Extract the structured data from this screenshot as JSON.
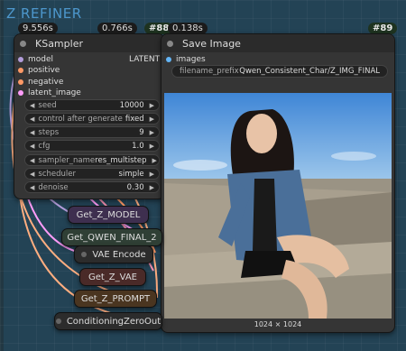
{
  "group": {
    "title": "Z REFINER"
  },
  "timings": {
    "ksampler_time": "9.556s",
    "t2": "0.766s",
    "node88_id": "#88",
    "t3": "0.138s",
    "node89_id": "#89"
  },
  "ksampler": {
    "title": "KSampler",
    "inputs": [
      "model",
      "positive",
      "negative",
      "latent_image"
    ],
    "output": "LATENT",
    "widgets": [
      {
        "label": "seed",
        "value": "10000"
      },
      {
        "label": "control after generate",
        "value": "fixed"
      },
      {
        "label": "steps",
        "value": "9"
      },
      {
        "label": "cfg",
        "value": "1.0"
      },
      {
        "label": "sampler_name",
        "value": "res_multistep"
      },
      {
        "label": "scheduler",
        "value": "simple"
      },
      {
        "label": "denoise",
        "value": "0.30"
      }
    ]
  },
  "save_image": {
    "title": "Save Image",
    "input": "images",
    "prefix_label": "filename_prefix",
    "prefix_value": "Qwen_Consistent_Char/Z_IMG_FINAL",
    "image_size": "1024 × 1024"
  },
  "small_nodes": [
    {
      "label": "Get_Z_MODEL"
    },
    {
      "label": "Get_QWEN_FINAL_2"
    },
    {
      "label": "VAE Encode"
    },
    {
      "label": "Get_Z_VAE"
    },
    {
      "label": "Get_Z_PROMPT"
    },
    {
      "label": "ConditioningZeroOut"
    }
  ],
  "colors": {
    "model": "#b39ddb",
    "positive": "#ff9966",
    "negative": "#ff9966",
    "latent": "#ff9cf9",
    "images": "#64b5f6"
  }
}
